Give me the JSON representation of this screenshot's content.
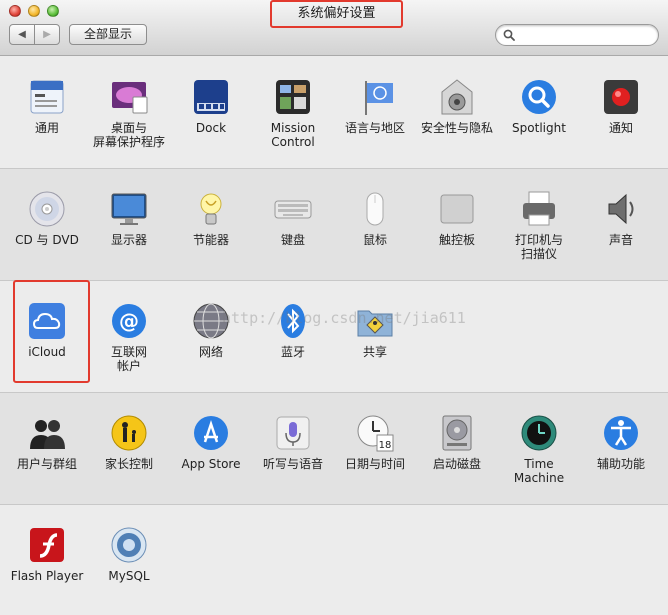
{
  "window": {
    "title": "系统偏好设置",
    "highlight_color": "#e23a2e"
  },
  "toolbar": {
    "back": "◀",
    "forward": "▶",
    "show_all": "全部显示",
    "search_placeholder": ""
  },
  "watermark": "http://blog.csdn.net/jia611",
  "sections": [
    {
      "items": [
        {
          "label": "通用",
          "icon": "general-icon"
        },
        {
          "label": "桌面与\n屏幕保护程序",
          "icon": "desktop-icon"
        },
        {
          "label": "Dock",
          "icon": "dock-icon"
        },
        {
          "label": "Mission\nControl",
          "icon": "mission-control-icon"
        },
        {
          "label": "语言与地区",
          "icon": "language-region-icon"
        },
        {
          "label": "安全性与隐私",
          "icon": "security-icon"
        },
        {
          "label": "Spotlight",
          "icon": "spotlight-icon"
        },
        {
          "label": "通知",
          "icon": "notifications-icon"
        }
      ]
    },
    {
      "items": [
        {
          "label": "CD 与 DVD",
          "icon": "cd-dvd-icon"
        },
        {
          "label": "显示器",
          "icon": "displays-icon"
        },
        {
          "label": "节能器",
          "icon": "energy-saver-icon"
        },
        {
          "label": "键盘",
          "icon": "keyboard-icon"
        },
        {
          "label": "鼠标",
          "icon": "mouse-icon"
        },
        {
          "label": "触控板",
          "icon": "trackpad-icon"
        },
        {
          "label": "打印机与\n扫描仪",
          "icon": "printer-icon"
        },
        {
          "label": "声音",
          "icon": "sound-icon"
        }
      ]
    },
    {
      "items": [
        {
          "label": "iCloud",
          "icon": "icloud-icon"
        },
        {
          "label": "互联网\n帐户",
          "icon": "internet-accounts-icon"
        },
        {
          "label": "网络",
          "icon": "network-icon"
        },
        {
          "label": "蓝牙",
          "icon": "bluetooth-icon"
        },
        {
          "label": "共享",
          "icon": "sharing-icon"
        }
      ]
    },
    {
      "items": [
        {
          "label": "用户与群组",
          "icon": "users-groups-icon"
        },
        {
          "label": "家长控制",
          "icon": "parental-controls-icon"
        },
        {
          "label": "App Store",
          "icon": "app-store-icon"
        },
        {
          "label": "听写与语音",
          "icon": "dictation-icon"
        },
        {
          "label": "日期与时间",
          "icon": "date-time-icon"
        },
        {
          "label": "启动磁盘",
          "icon": "startup-disk-icon"
        },
        {
          "label": "Time Machine",
          "icon": "time-machine-icon"
        },
        {
          "label": "辅助功能",
          "icon": "accessibility-icon"
        }
      ]
    },
    {
      "items": [
        {
          "label": "Flash Player",
          "icon": "flash-player-icon"
        },
        {
          "label": "MySQL",
          "icon": "mysql-icon"
        }
      ]
    }
  ]
}
